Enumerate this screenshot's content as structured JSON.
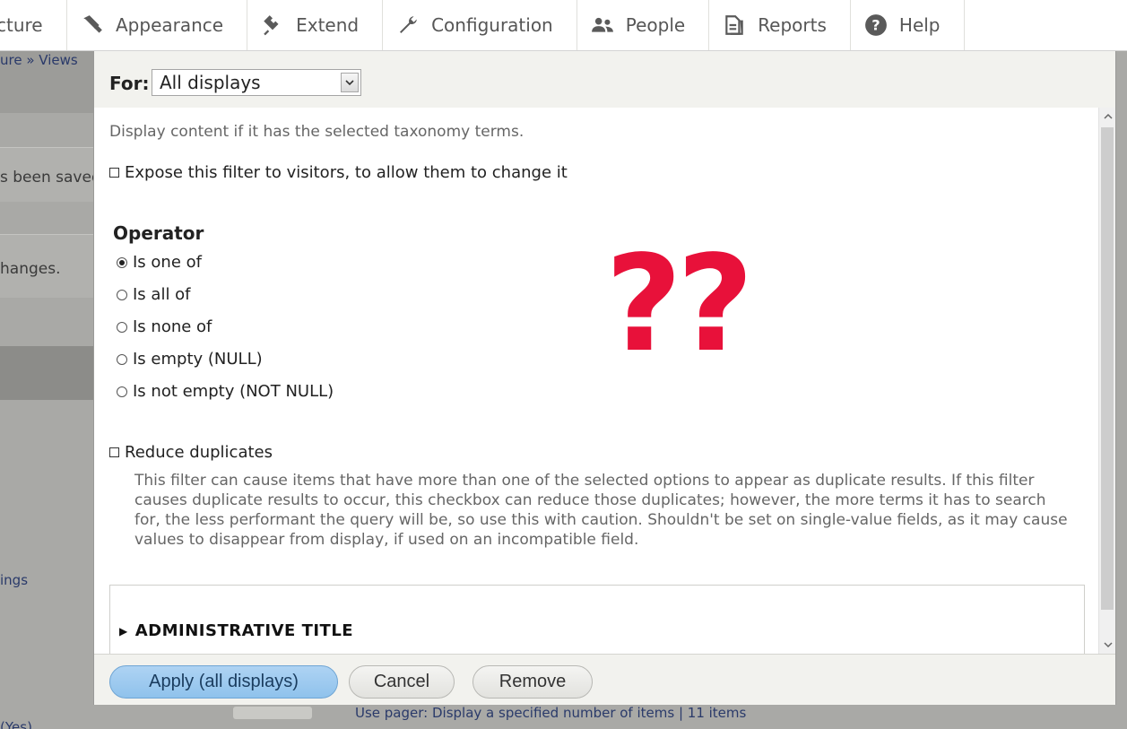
{
  "toolbar": {
    "items": [
      {
        "label": "cture",
        "icon": "structure-icon"
      },
      {
        "label": "Appearance",
        "icon": "paintbrush-icon"
      },
      {
        "label": "Extend",
        "icon": "plug-icon"
      },
      {
        "label": "Configuration",
        "icon": "wrench-icon"
      },
      {
        "label": "People",
        "icon": "people-icon"
      },
      {
        "label": "Reports",
        "icon": "reports-icon"
      },
      {
        "label": "Help",
        "icon": "help-icon"
      }
    ]
  },
  "background": {
    "breadcrumb": "ure » Views",
    "saved_text": "s been saved",
    "changes_text": "hanges.",
    "settings_link": "ings",
    "yes_text": "(Yes)",
    "pager_text": "Use pager:  Display a specified number of items  |  11 items"
  },
  "modal": {
    "for_label": "For:",
    "for_select_value": "All displays",
    "description": "Display content if it has the selected taxonomy terms.",
    "expose_label": "Expose this filter to visitors, to allow them to change it",
    "operator_title": "Operator",
    "operators": [
      {
        "label": "Is one of",
        "checked": true
      },
      {
        "label": "Is all of",
        "checked": false
      },
      {
        "label": "Is none of",
        "checked": false
      },
      {
        "label": "Is empty (NULL)",
        "checked": false
      },
      {
        "label": "Is not empty (NOT NULL)",
        "checked": false
      }
    ],
    "reduce_label": "Reduce duplicates",
    "reduce_help": "This filter can cause items that have more than one of the selected options to appear as duplicate results. If this filter causes duplicate results to occur, this checkbox can reduce those duplicates; however, the more terms it has to search for, the less performant the query will be, so use this with caution. Shouldn't be set on single-value fields, as it may cause values to disappear from display, if used on an incompatible field.",
    "annotation": "??",
    "admin_title": "ADMINISTRATIVE TITLE",
    "buttons": {
      "apply": "Apply (all displays)",
      "cancel": "Cancel",
      "remove": "Remove"
    }
  },
  "colors": {
    "annotation": "#e8113a",
    "primary_button": "#9ccaf0"
  }
}
